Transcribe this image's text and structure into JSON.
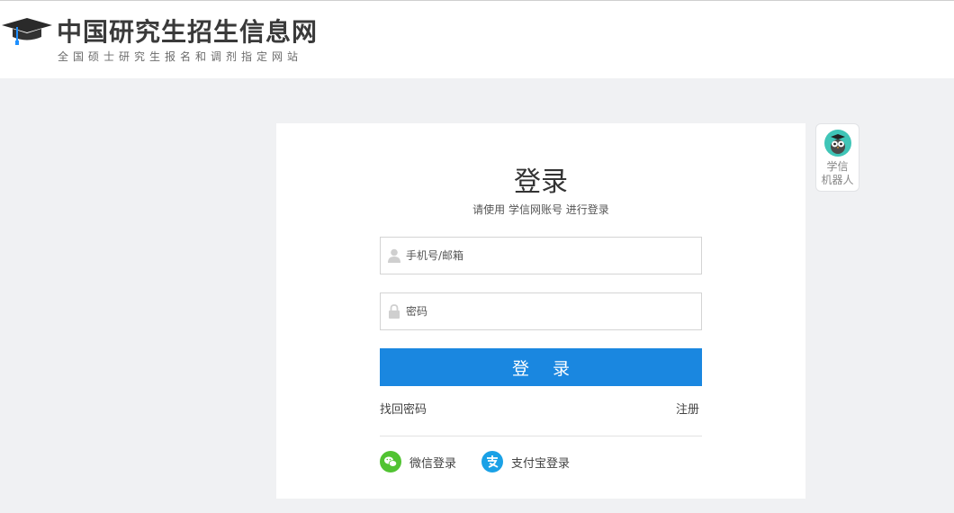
{
  "header": {
    "title": "中国研究生招生信息网",
    "subtitle": "全国硕士研究生报名和调剂指定网站"
  },
  "login": {
    "title": "登录",
    "subtitle": "请使用 学信网账号 进行登录",
    "username_placeholder": "手机号/邮箱",
    "username_value": "",
    "password_placeholder": "密码",
    "password_value": "",
    "submit_label": "登 录",
    "forgot_label": "找回密码",
    "register_label": "注册",
    "wechat_label": "微信登录",
    "alipay_label": "支付宝登录"
  },
  "robot": {
    "label_line1": "学信",
    "label_line2": "机器人"
  },
  "colors": {
    "accent": "#1a87e0",
    "wechat": "#51c332",
    "alipay": "#1aa1e6",
    "page_bg": "#f0f1f3"
  },
  "icons": {
    "logo": "graduation-cap-icon",
    "username": "user-icon",
    "password": "lock-icon",
    "wechat": "wechat-icon",
    "alipay": "alipay-icon",
    "robot": "owl-robot-icon"
  }
}
